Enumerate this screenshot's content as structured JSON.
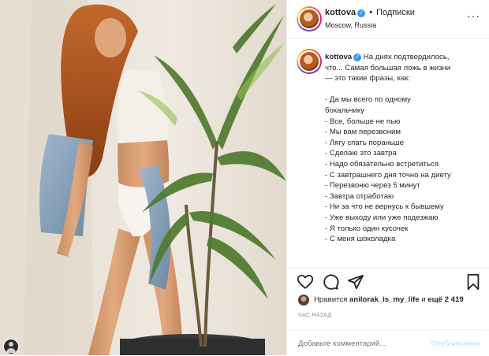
{
  "header": {
    "username": "kottova",
    "separator": "•",
    "follow_label": "Подписки",
    "location": "Moscow, Russia",
    "more_label": "···"
  },
  "caption": {
    "username": "kottova",
    "lines": [
      "На днях подтвердилось,",
      "что... Самая большая ложь в жизни",
      "— это такие фразы, как:",
      "",
      "- Да мы всего по одному",
      "бокальчику",
      "- Все, больше не пью",
      "- Мы вам перезвоним",
      "- Лягу спать пораньше",
      "- Сделаю это завтра",
      "- Надо обязательно встретиться",
      "- С завтрашнего дня точно на диету",
      "- Перезвоню через 5 минут",
      "- Завтра отработаю",
      "- Ни за что не вернусь к бывшему",
      "- Уже выходу или уже подезжаю",
      "- Я только один кусочек",
      "- С меня шоколадка"
    ]
  },
  "likes": {
    "prefix": "Нравится",
    "user": "anilorak_is_my_life",
    "suffix": "и",
    "count": "ещё 2 419"
  },
  "time_ago": "ЧАС НАЗАД",
  "comment": {
    "placeholder": "Добавьте комментарий...",
    "post_label": "Опубликовать"
  },
  "colors": {
    "accent": "#3897f0",
    "post_disabled": "#b2dffc",
    "muted": "#8e8e8e"
  },
  "icons": [
    "heart-icon",
    "comment-icon",
    "share-icon",
    "bookmark-icon",
    "verified-icon",
    "more-icon"
  ]
}
